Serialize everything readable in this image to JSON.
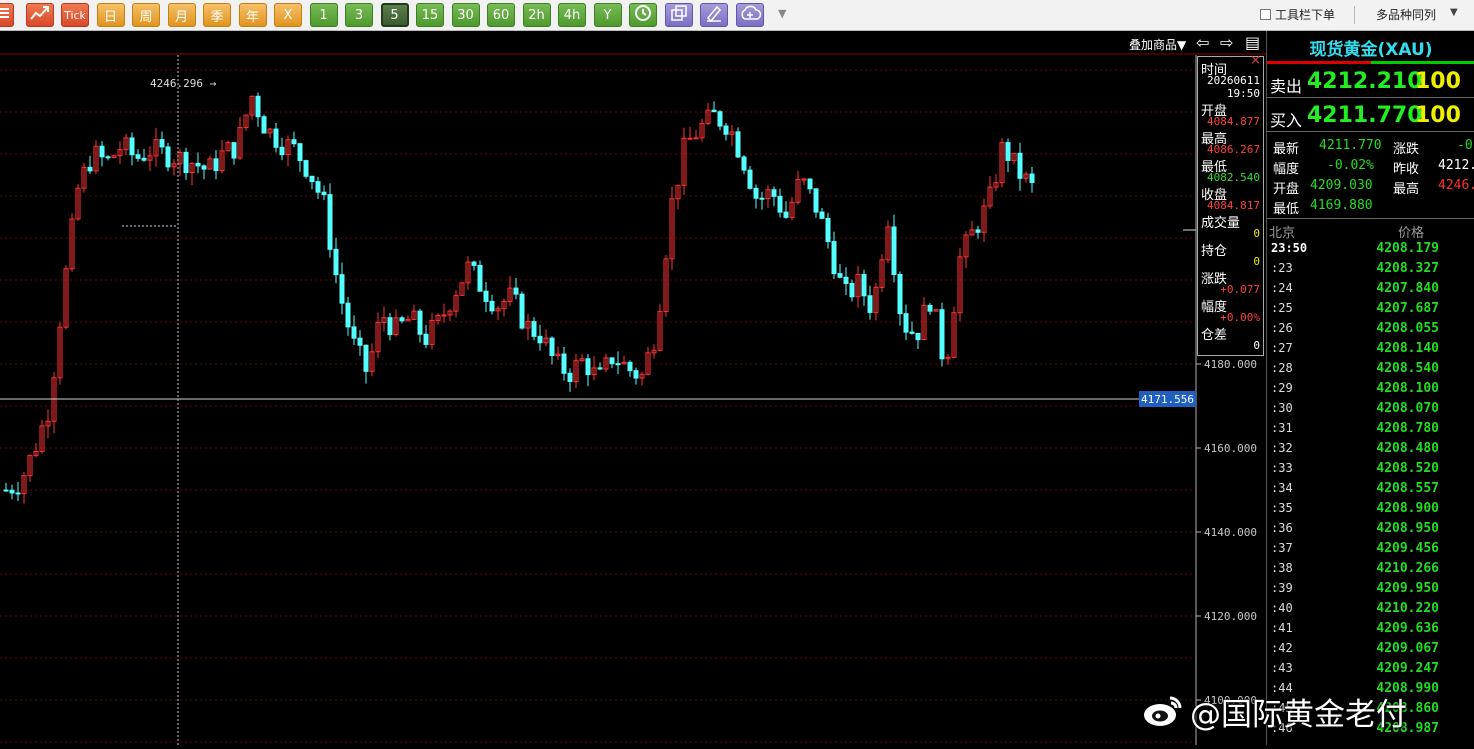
{
  "toolbar": {
    "buttons": [
      {
        "label": "☰",
        "icon": "menu-icon",
        "color": "red"
      },
      {
        "label": "",
        "icon": "trend-chart-icon",
        "color": "red"
      },
      {
        "label": "Tick",
        "icon": "",
        "color": "red"
      },
      {
        "label": "日",
        "icon": "",
        "color": "orange"
      },
      {
        "label": "周",
        "icon": "",
        "color": "orange"
      },
      {
        "label": "月",
        "icon": "",
        "color": "orange"
      },
      {
        "label": "季",
        "icon": "",
        "color": "orange"
      },
      {
        "label": "年",
        "icon": "",
        "color": "orange"
      },
      {
        "label": "X",
        "icon": "",
        "color": "orange"
      },
      {
        "label": "1",
        "icon": "",
        "color": "green"
      },
      {
        "label": "3",
        "icon": "",
        "color": "green"
      },
      {
        "label": "5",
        "icon": "",
        "color": "dgreen"
      },
      {
        "label": "15",
        "icon": "",
        "color": "green"
      },
      {
        "label": "30",
        "icon": "",
        "color": "green"
      },
      {
        "label": "60",
        "icon": "",
        "color": "green"
      },
      {
        "label": "2h",
        "icon": "",
        "color": "green"
      },
      {
        "label": "4h",
        "icon": "",
        "color": "green"
      },
      {
        "label": "Y",
        "icon": "",
        "color": "green"
      },
      {
        "label": "",
        "icon": "clock-icon",
        "color": "green"
      },
      {
        "label": "",
        "icon": "windows-icon",
        "color": "purple"
      },
      {
        "label": "",
        "icon": "draw-icon",
        "color": "purple"
      },
      {
        "label": "",
        "icon": "cloud-icon",
        "color": "purple"
      }
    ],
    "dropdown_arrow": "▼",
    "toolbar_order_label": "工具栏下单",
    "multi_period_label": "多品种同列",
    "multi_period_arrow": "▼"
  },
  "chart": {
    "overlay_label": "叠加商品▼",
    "nav_left": "⇦",
    "nav_right": "⇨",
    "layout_icon": "▤",
    "high_annotation": "4246.296 →",
    "crosshair_price": "4171.556",
    "colors": {
      "up": "#ff3232",
      "down": "#54ffff",
      "grid": "#6e0000",
      "axis_text": "#c8c8c8"
    }
  },
  "chart_data": {
    "type": "candlestick",
    "yaxis": {
      "ticks": [
        4180,
        4160,
        4140,
        4120,
        4100
      ],
      "tick_labels": [
        "4180.000",
        "4160.000",
        "4140.000",
        "4120.000",
        "4100.000"
      ],
      "grid": true
    },
    "close_path": [
      4150,
      4152,
      4160,
      4170,
      4198,
      4222,
      4230,
      4228,
      4232,
      4229,
      4231,
      4230,
      4229,
      4228,
      4226,
      4230,
      4232,
      4244,
      4236,
      4233,
      4231,
      4226,
      4218,
      4198,
      4185,
      4178,
      4192,
      4188,
      4191,
      4186,
      4190,
      4197,
      4203,
      4198,
      4194,
      4196,
      4189,
      4187,
      4180,
      4178,
      4181,
      4176,
      4182,
      4179,
      4177,
      4188,
      4217,
      4232,
      4236,
      4239,
      4237,
      4229,
      4219,
      4221,
      4215,
      4224,
      4218,
      4208,
      4196,
      4199,
      4193,
      4216,
      4190,
      4187,
      4196,
      4179,
      4205,
      4212,
      4218,
      4232,
      4226,
      4222
    ]
  },
  "info_box": {
    "time_label": "时间",
    "date_value": "20260611",
    "time_value": "19:50",
    "open_label": "开盘",
    "open_value": "4084.877",
    "high_label": "最高",
    "high_value": "4086.267",
    "low_label": "最低",
    "low_value": "4082.540",
    "close_label": "收盘",
    "close_value": "4084.817",
    "volume_label": "成交量",
    "volume_value": "0",
    "position_label": "持仓",
    "position_value": "0",
    "change_label": "涨跌",
    "change_value": "+0.077",
    "pct_label": "幅度",
    "pct_value": "+0.00%",
    "diff_label": "仓差",
    "diff_value": "0",
    "close_x": "×"
  },
  "panel": {
    "title": "现货黄金(XAU)",
    "sell_label": "卖出",
    "sell_price": "4212.210",
    "sell_qty": "100",
    "buy_label": "买入",
    "buy_price": "4211.770",
    "buy_qty": "100",
    "stats": {
      "latest_label": "最新",
      "latest_value": "4211.770",
      "change_label": "涨跌",
      "change_value": "-0.",
      "pct_label": "幅度",
      "pct_value": "-0.02%",
      "prev_label": "昨收",
      "prev_value": "4212.",
      "open_label": "开盘",
      "open_value": "4209.030",
      "high_label": "最高",
      "high_value": "4246.",
      "low_label": "最低",
      "low_value": "4169.880"
    },
    "tick_header_time": "北京",
    "tick_header_price": "价格",
    "ticks": [
      {
        "time": "23:50",
        "price": "4208.179"
      },
      {
        "time": ":23",
        "price": "4208.327"
      },
      {
        "time": ":24",
        "price": "4207.840"
      },
      {
        "time": ":25",
        "price": "4207.687"
      },
      {
        "time": ":26",
        "price": "4208.055"
      },
      {
        "time": ":27",
        "price": "4208.140"
      },
      {
        "time": ":28",
        "price": "4208.540"
      },
      {
        "time": ":29",
        "price": "4208.100"
      },
      {
        "time": ":30",
        "price": "4208.070"
      },
      {
        "time": ":31",
        "price": "4208.780"
      },
      {
        "time": ":32",
        "price": "4208.480"
      },
      {
        "time": ":33",
        "price": "4208.520"
      },
      {
        "time": ":34",
        "price": "4208.557"
      },
      {
        "time": ":35",
        "price": "4208.900"
      },
      {
        "time": ":36",
        "price": "4208.950"
      },
      {
        "time": ":37",
        "price": "4209.456"
      },
      {
        "time": ":38",
        "price": "4210.266"
      },
      {
        "time": ":39",
        "price": "4209.950"
      },
      {
        "time": ":40",
        "price": "4210.220"
      },
      {
        "time": ":41",
        "price": "4209.636"
      },
      {
        "time": ":42",
        "price": "4209.067"
      },
      {
        "time": ":43",
        "price": "4209.247"
      },
      {
        "time": ":44",
        "price": "4208.990"
      },
      {
        "time": ":45",
        "price": "4208.860"
      },
      {
        "time": ":46",
        "price": "4208.987"
      }
    ],
    "colors": {
      "up": "#ff3030",
      "down": "#22dd22",
      "title": "#33ddee",
      "qty": "#eeee00"
    }
  },
  "watermark": {
    "text": "@国际黄金老付"
  }
}
